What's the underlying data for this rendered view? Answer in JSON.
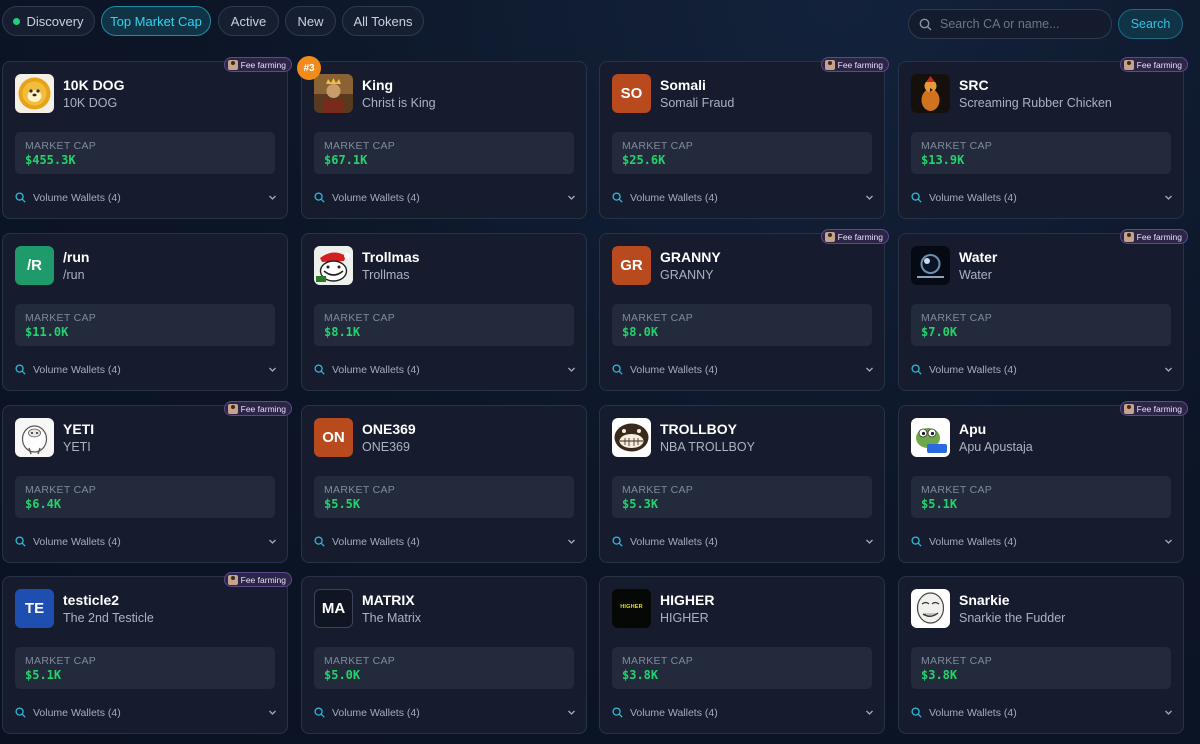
{
  "filters": {
    "discovery": "Discovery",
    "top_market_cap": "Top Market Cap",
    "active": "Active",
    "new": "New",
    "all_tokens": "All Tokens"
  },
  "search": {
    "placeholder": "Search CA or name...",
    "button": "Search"
  },
  "labels": {
    "market_cap": "MARKET CAP",
    "volume_wallets": "Volume Wallets (4)",
    "fee_farming": "Fee farming"
  },
  "colors": {
    "accent": "#2fd3ee",
    "value_green": "#22d36c",
    "rank_orange": "#f28b1a"
  },
  "cards": [
    {
      "name": "10K DOG",
      "sub": "10K DOG",
      "mcap": "$455.3K",
      "fee": true,
      "avatar": "dog-logo-icon"
    },
    {
      "name": "King",
      "sub": "Christ is King",
      "mcap": "$67.1K",
      "rank": "#3",
      "avatar": "king-image-icon"
    },
    {
      "name": "Somali",
      "sub": "Somali Fraud",
      "mcap": "$25.6K",
      "fee": true,
      "initials": "SO",
      "bg": "#b84a1e"
    },
    {
      "name": "SRC",
      "sub": "Screaming Rubber Chicken",
      "mcap": "$13.9K",
      "fee": true,
      "avatar": "chicken-image-icon"
    },
    {
      "name": "/run",
      "sub": "/run",
      "mcap": "$11.0K",
      "initials": "/R",
      "bg": "#1f9a6a"
    },
    {
      "name": "Trollmas",
      "sub": "Trollmas",
      "mcap": "$8.1K",
      "avatar": "trollmas-image-icon"
    },
    {
      "name": "GRANNY",
      "sub": "GRANNY",
      "mcap": "$8.0K",
      "fee": true,
      "initials": "GR",
      "bg": "#b84a1e"
    },
    {
      "name": "Water",
      "sub": "Water",
      "mcap": "$7.0K",
      "fee": true,
      "avatar": "water-image-icon"
    },
    {
      "name": "YETI",
      "sub": "YETI",
      "mcap": "$6.4K",
      "fee": true,
      "avatar": "yeti-image-icon"
    },
    {
      "name": "ONE369",
      "sub": "ONE369",
      "mcap": "$5.5K",
      "initials": "ON",
      "bg": "#b84a1e"
    },
    {
      "name": "TROLLBOY",
      "sub": "NBA TROLLBOY",
      "mcap": "$5.3K",
      "avatar": "trollface-image-icon"
    },
    {
      "name": "Apu",
      "sub": "Apu Apustaja",
      "mcap": "$5.1K",
      "fee": true,
      "avatar": "apu-frog-image-icon"
    },
    {
      "name": "testicle2",
      "sub": "The 2nd Testicle",
      "mcap": "$5.1K",
      "fee": true,
      "initials": "TE",
      "bg": "#1e4fb0"
    },
    {
      "name": "MATRIX",
      "sub": "The Matrix",
      "mcap": "$5.0K",
      "initials": "MA",
      "bg": "#0f1522"
    },
    {
      "name": "HIGHER",
      "sub": "HIGHER",
      "mcap": "$3.8K",
      "avatar": "higher-logo-icon",
      "avatar_text": "HIGHER"
    },
    {
      "name": "Snarkie",
      "sub": "Snarkie the Fudder",
      "mcap": "$3.8K",
      "avatar": "snarkie-image-icon"
    }
  ]
}
